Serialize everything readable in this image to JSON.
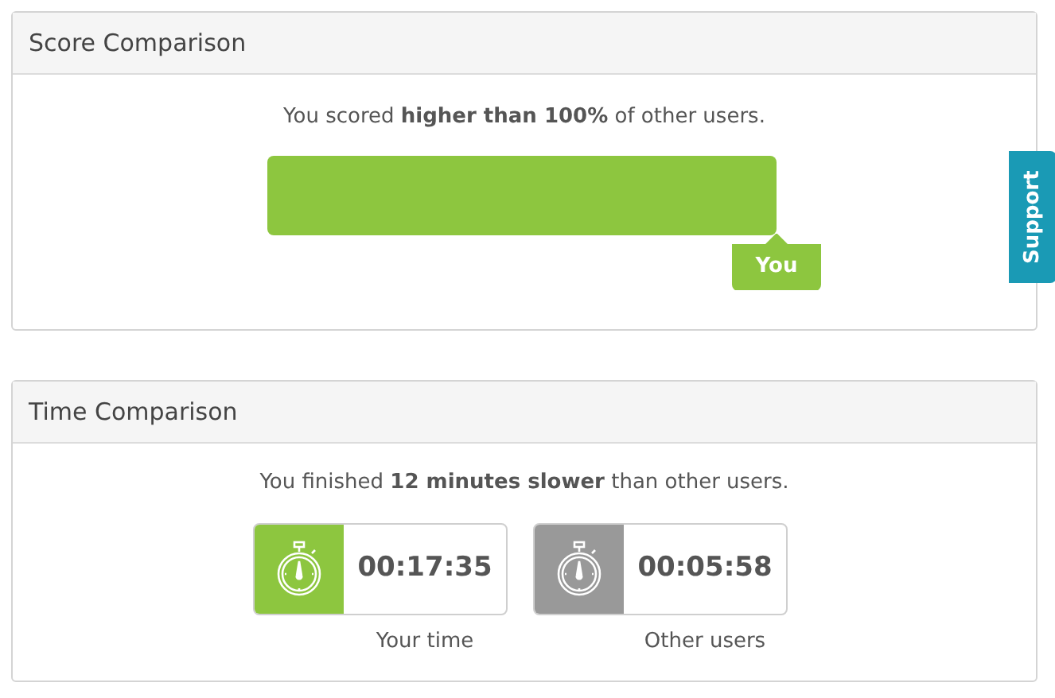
{
  "score_panel": {
    "title": "Score Comparison",
    "summary": "You scored **higher than 100%** of other users.",
    "bar": {
      "marker": "You"
    }
  },
  "time_panel": {
    "title": "Time Comparison",
    "summary": "You finished **12 minutes slower** than other users.",
    "timers": [
      {
        "time": "00:17:35",
        "caption": "Your time",
        "color": "#8dc63f"
      },
      {
        "time": "00:05:58",
        "caption": "Other users",
        "color": "#999999"
      }
    ]
  },
  "support_tab": {
    "label": "Support"
  }
}
